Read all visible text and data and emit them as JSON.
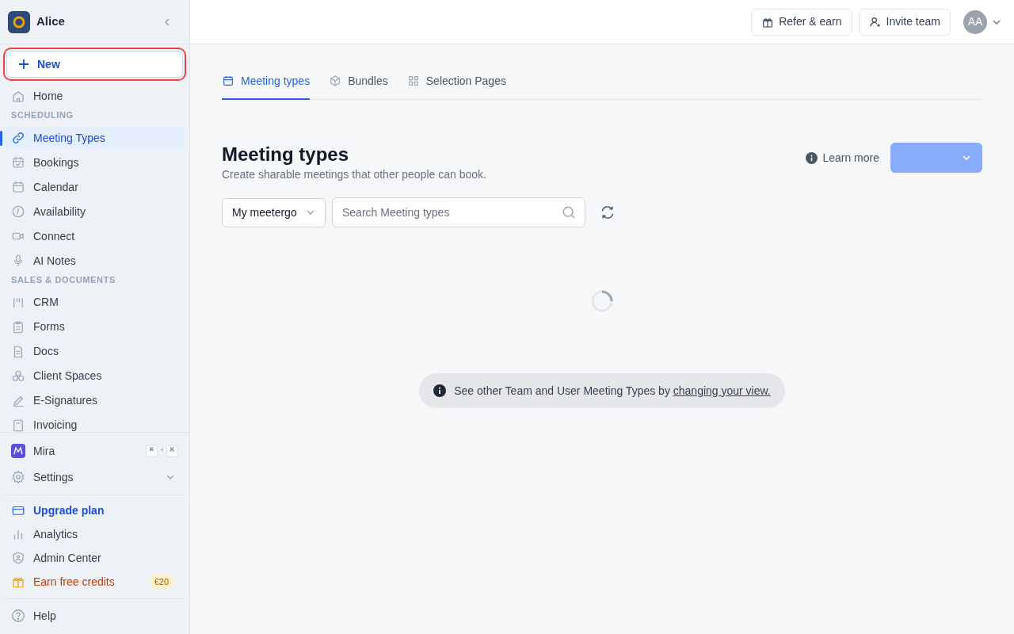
{
  "workspace": {
    "name": "Alice"
  },
  "new_button": {
    "label": "New"
  },
  "nav": [
    {
      "kind": "item",
      "label": "Home",
      "selected": false
    },
    {
      "kind": "heading",
      "label": "SCHEDULING"
    },
    {
      "kind": "item",
      "label": "Meeting Types",
      "selected": true
    },
    {
      "kind": "item",
      "label": "Bookings",
      "selected": false
    },
    {
      "kind": "item",
      "label": "Calendar",
      "selected": false
    },
    {
      "kind": "item",
      "label": "Availability",
      "selected": false
    },
    {
      "kind": "item",
      "label": "Connect",
      "selected": false
    },
    {
      "kind": "item",
      "label": "AI Notes",
      "selected": false
    },
    {
      "kind": "heading",
      "label": "SALES & DOCUMENTS"
    },
    {
      "kind": "item",
      "label": "CRM",
      "selected": false
    },
    {
      "kind": "item",
      "label": "Forms",
      "selected": false
    },
    {
      "kind": "item",
      "label": "Docs",
      "selected": false
    },
    {
      "kind": "item",
      "label": "Client Spaces",
      "selected": false
    },
    {
      "kind": "item",
      "label": "E-Signatures",
      "selected": false
    },
    {
      "kind": "item",
      "label": "Invoicing",
      "selected": false
    }
  ],
  "mira": {
    "label": "Mira",
    "shortcut": [
      "⌘",
      "+",
      "K"
    ]
  },
  "settings": {
    "label": "Settings",
    "expanded": false
  },
  "bottom_nav": [
    {
      "kind": "upgrade",
      "label": "Upgrade plan"
    },
    {
      "kind": "item",
      "label": "Analytics"
    },
    {
      "kind": "item",
      "label": "Admin Center"
    },
    {
      "kind": "credits",
      "label": "Earn free credits",
      "badge": "€20"
    }
  ],
  "help": {
    "label": "Help"
  },
  "top_bar": {
    "buttons": [
      "Refer & earn",
      "Invite team"
    ],
    "avatar": "AA"
  },
  "tabs": [
    {
      "label": "Meeting types",
      "selected": true
    },
    {
      "label": "Bundles",
      "selected": false
    },
    {
      "label": "Selection Pages",
      "selected": false
    }
  ],
  "page": {
    "title": "Meeting types",
    "subtitle": "Create sharable meetings that other people can book.",
    "learn_more": "Learn more"
  },
  "filter": {
    "value": "My meetergo"
  },
  "search": {
    "placeholder": "Search Meeting types"
  },
  "notice": {
    "text": "See other Team and User Meeting Types by ",
    "link": "changing your view."
  }
}
